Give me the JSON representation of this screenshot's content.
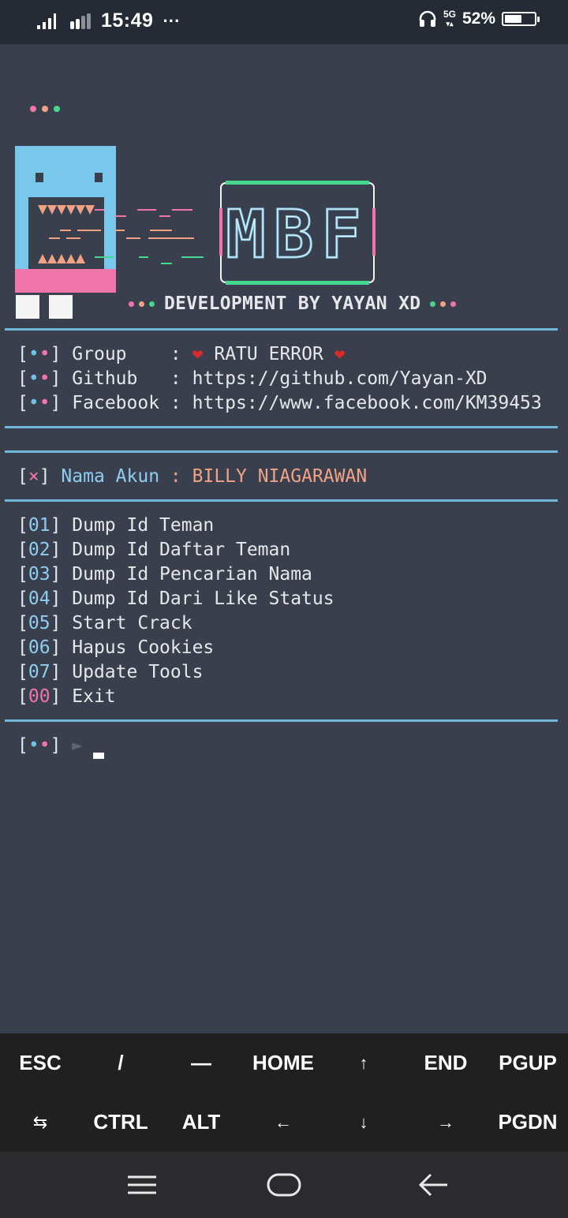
{
  "status_bar": {
    "time": "15:49",
    "more_indicator": "···",
    "network": "5G",
    "battery_percent": "52%",
    "battery_level": 0.52,
    "icons": [
      "signal-icon",
      "signal-2-icon",
      "headphones-icon",
      "network-5g-icon",
      "battery-icon"
    ]
  },
  "terminal": {
    "logo_text": "MBF",
    "developer_line": "DEVELOPMENT BY YAYAN XD",
    "info": [
      {
        "bracket": "[••]",
        "label": "Group   ",
        "sep": ":",
        "value": "RATU ERROR"
      },
      {
        "bracket": "[••]",
        "label": "Github  ",
        "sep": ":",
        "value": "https://github.com/Yayan-XD"
      },
      {
        "bracket": "[••]",
        "label": "Facebook",
        "sep": ":",
        "value": "https://www.facebook.com/KM39453"
      }
    ],
    "account": {
      "marker": "[×]",
      "label": "Nama Akun",
      "sep": ":",
      "value": "BILLY NIAGARAWAN"
    },
    "menu": [
      {
        "num": "01",
        "label": "Dump Id Teman"
      },
      {
        "num": "02",
        "label": "Dump Id Daftar Teman"
      },
      {
        "num": "03",
        "label": "Dump Id Pencarian Nama"
      },
      {
        "num": "04",
        "label": "Dump Id Dari Like Status"
      },
      {
        "num": "05",
        "label": "Start Crack"
      },
      {
        "num": "06",
        "label": "Hapus Cookies"
      },
      {
        "num": "07",
        "label": "Update Tools"
      },
      {
        "num": "00",
        "label": "Exit"
      }
    ],
    "prompt": {
      "bracket": "[••]",
      "arrow": "►"
    }
  },
  "extra_keys": {
    "row1": [
      "ESC",
      "/",
      "—",
      "HOME",
      "↑",
      "END",
      "PGUP"
    ],
    "row2": [
      "⇆",
      "CTRL",
      "ALT",
      "←",
      "↓",
      "→",
      "PGDN"
    ]
  },
  "colors": {
    "background": "#3a3f4e",
    "accent_blue": "#6fc1e6",
    "accent_pink": "#f075a9",
    "accent_green": "#45d68f",
    "accent_salmon": "#f1a184",
    "heart_red": "#d92b2b"
  }
}
